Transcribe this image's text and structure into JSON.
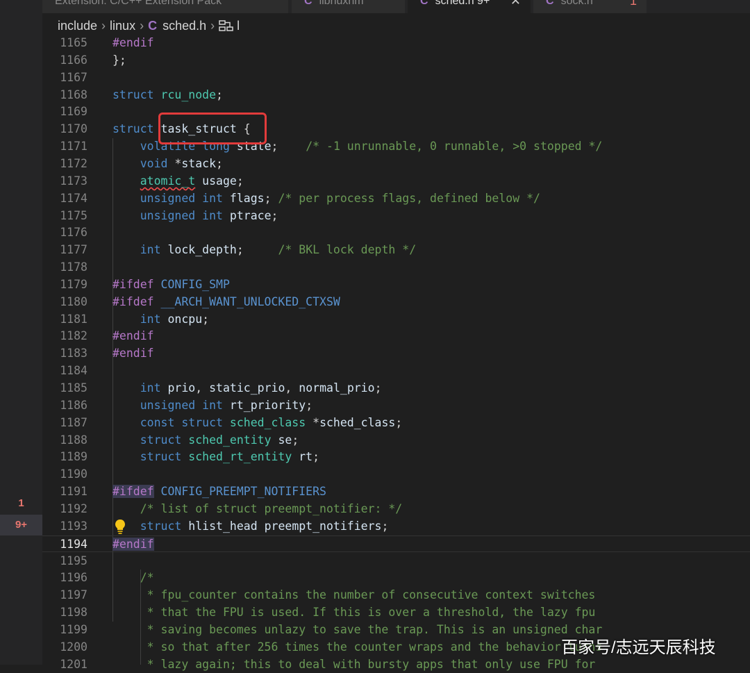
{
  "tabs": [
    {
      "icon": "",
      "label": "Extension: C/C++ Extension Pack",
      "close": ""
    },
    {
      "icon": "C",
      "label": "libnuxnm",
      "close": ""
    },
    {
      "icon": "C",
      "label": "sched.h 9+",
      "close": "✕"
    },
    {
      "icon": "C",
      "label": "sock.h",
      "close": "1"
    }
  ],
  "breadcrumb": {
    "parts": [
      "include",
      "linux"
    ],
    "file_icon": "C",
    "file": "sched.h",
    "symbol_icon": "symbol-structure-icon",
    "trailing": "l"
  },
  "activity_badges": [
    "1",
    "9+"
  ],
  "editor": {
    "current_line": "1194",
    "lines": [
      {
        "n": "1165",
        "t": "#endif"
      },
      {
        "n": "1166",
        "t": "};"
      },
      {
        "n": "1167",
        "t": ""
      },
      {
        "n": "1168",
        "t": "struct rcu_node;"
      },
      {
        "n": "1169",
        "t": ""
      },
      {
        "n": "1170",
        "t": "struct task_struct {"
      },
      {
        "n": "1171",
        "t": "    volatile long state;    /* -1 unrunnable, 0 runnable, >0 stopped */"
      },
      {
        "n": "1172",
        "t": "    void *stack;"
      },
      {
        "n": "1173",
        "t": "    atomic_t usage;"
      },
      {
        "n": "1174",
        "t": "    unsigned int flags; /* per process flags, defined below */"
      },
      {
        "n": "1175",
        "t": "    unsigned int ptrace;"
      },
      {
        "n": "1176",
        "t": ""
      },
      {
        "n": "1177",
        "t": "    int lock_depth;     /* BKL lock depth */"
      },
      {
        "n": "1178",
        "t": ""
      },
      {
        "n": "1179",
        "t": "#ifdef CONFIG_SMP"
      },
      {
        "n": "1180",
        "t": "#ifdef __ARCH_WANT_UNLOCKED_CTXSW"
      },
      {
        "n": "1181",
        "t": "    int oncpu;"
      },
      {
        "n": "1182",
        "t": "#endif"
      },
      {
        "n": "1183",
        "t": "#endif"
      },
      {
        "n": "1184",
        "t": ""
      },
      {
        "n": "1185",
        "t": "    int prio, static_prio, normal_prio;"
      },
      {
        "n": "1186",
        "t": "    unsigned int rt_priority;"
      },
      {
        "n": "1187",
        "t": "    const struct sched_class *sched_class;"
      },
      {
        "n": "1188",
        "t": "    struct sched_entity se;"
      },
      {
        "n": "1189",
        "t": "    struct sched_rt_entity rt;"
      },
      {
        "n": "1190",
        "t": ""
      },
      {
        "n": "1191",
        "t": "#ifdef CONFIG_PREEMPT_NOTIFIERS"
      },
      {
        "n": "1192",
        "t": "    /* list of struct preempt_notifier: */"
      },
      {
        "n": "1193",
        "t": "    struct hlist_head preempt_notifiers;"
      },
      {
        "n": "1194",
        "t": "#endif"
      },
      {
        "n": "1195",
        "t": ""
      },
      {
        "n": "1196",
        "t": "    /*"
      },
      {
        "n": "1197",
        "t": "     * fpu_counter contains the number of consecutive context switches"
      },
      {
        "n": "1198",
        "t": "     * that the FPU is used. If this is over a threshold, the lazy fpu"
      },
      {
        "n": "1199",
        "t": "     * saving becomes unlazy to save the trap. This is an unsigned char"
      },
      {
        "n": "1200",
        "t": "     * so that after 256 times the counter wraps and the behavior turns"
      },
      {
        "n": "1201",
        "t": "     * lazy again; this to deal with bursty apps that only use FPU for"
      }
    ]
  },
  "watermark": "百家号/志远天辰科技",
  "colors": {
    "editor_bg": "#1f1f1f",
    "keyword": "#4f8ccb",
    "type": "#4ec9b0",
    "preprocessor": "#b678c9",
    "comment": "#6a9955",
    "annotation_box": "#e23b3b",
    "badge": "#e8766f"
  }
}
